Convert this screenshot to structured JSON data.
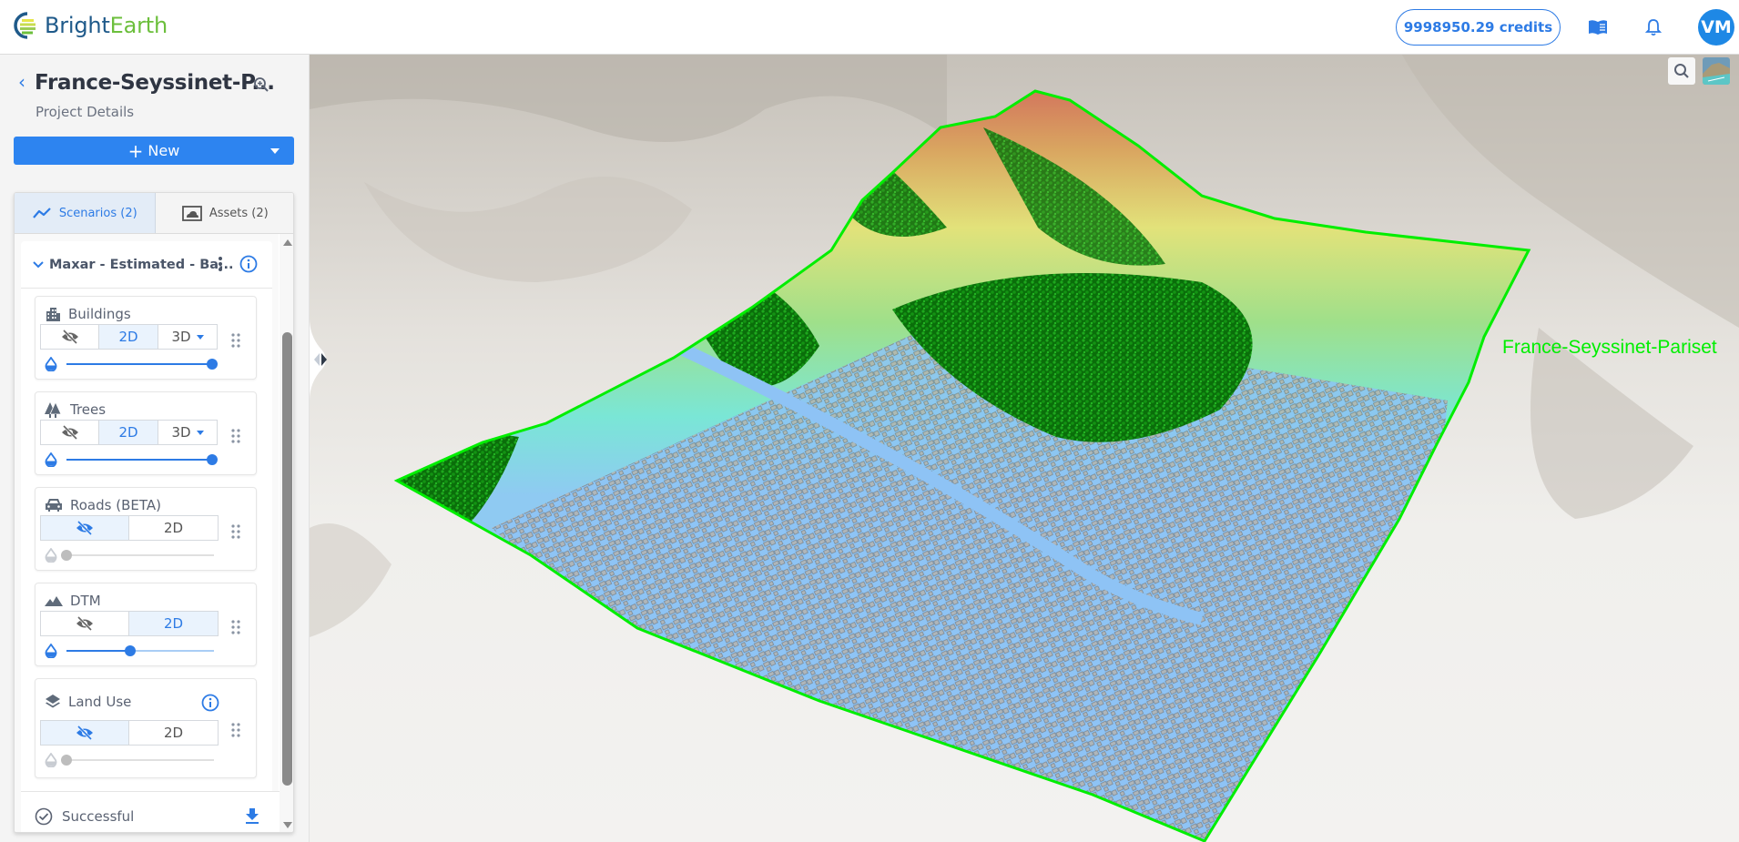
{
  "header": {
    "logo_part1": "Bright",
    "logo_part2": "Earth",
    "credits": "9998950.29 credits",
    "avatar_initials": "VM",
    "icons": [
      "book-icon",
      "bell-icon"
    ]
  },
  "project": {
    "title": "France-Seyssinet-P...",
    "subtitle": "Project Details",
    "new_button": "New"
  },
  "tabs": [
    {
      "label": "Scenarios (2)",
      "icon": "chart-line-icon",
      "active": true
    },
    {
      "label": "Assets (2)",
      "icon": "cloud-image-icon",
      "active": false
    }
  ],
  "scenario": {
    "title": "Maxar - Estimated - Ba...",
    "status": "Successful",
    "layers": [
      {
        "name": "Buildings",
        "icon": "building-icon",
        "modes": [
          "hidden",
          "2D",
          "3D"
        ],
        "selected": "2D",
        "has_3d_dropdown": true,
        "opacity": 1.0,
        "enabled": true
      },
      {
        "name": "Trees",
        "icon": "trees-icon",
        "modes": [
          "hidden",
          "2D",
          "3D"
        ],
        "selected": "2D",
        "has_3d_dropdown": true,
        "opacity": 1.0,
        "enabled": true
      },
      {
        "name": "Roads (BETA)",
        "icon": "car-icon",
        "modes": [
          "hidden",
          "2D"
        ],
        "selected": "hidden",
        "opacity": 0.0,
        "enabled": false
      },
      {
        "name": "DTM",
        "icon": "mountain-icon",
        "modes": [
          "hidden",
          "2D"
        ],
        "selected": "2D",
        "opacity": 0.45,
        "enabled": true
      },
      {
        "name": "Land Use",
        "icon": "layers-icon",
        "modes": [
          "hidden",
          "2D"
        ],
        "selected": "hidden",
        "opacity": 0.0,
        "enabled": false,
        "has_info": true
      }
    ],
    "mode_labels": {
      "two_d": "2D",
      "three_d": "3D"
    }
  },
  "map": {
    "aoi_label": "France-Seyssinet-Pariset",
    "aoi_color": "#00ee00"
  },
  "colors": {
    "accent": "#2d7be5",
    "new_button": "#2d84f0",
    "avatar": "#1e88e5"
  }
}
